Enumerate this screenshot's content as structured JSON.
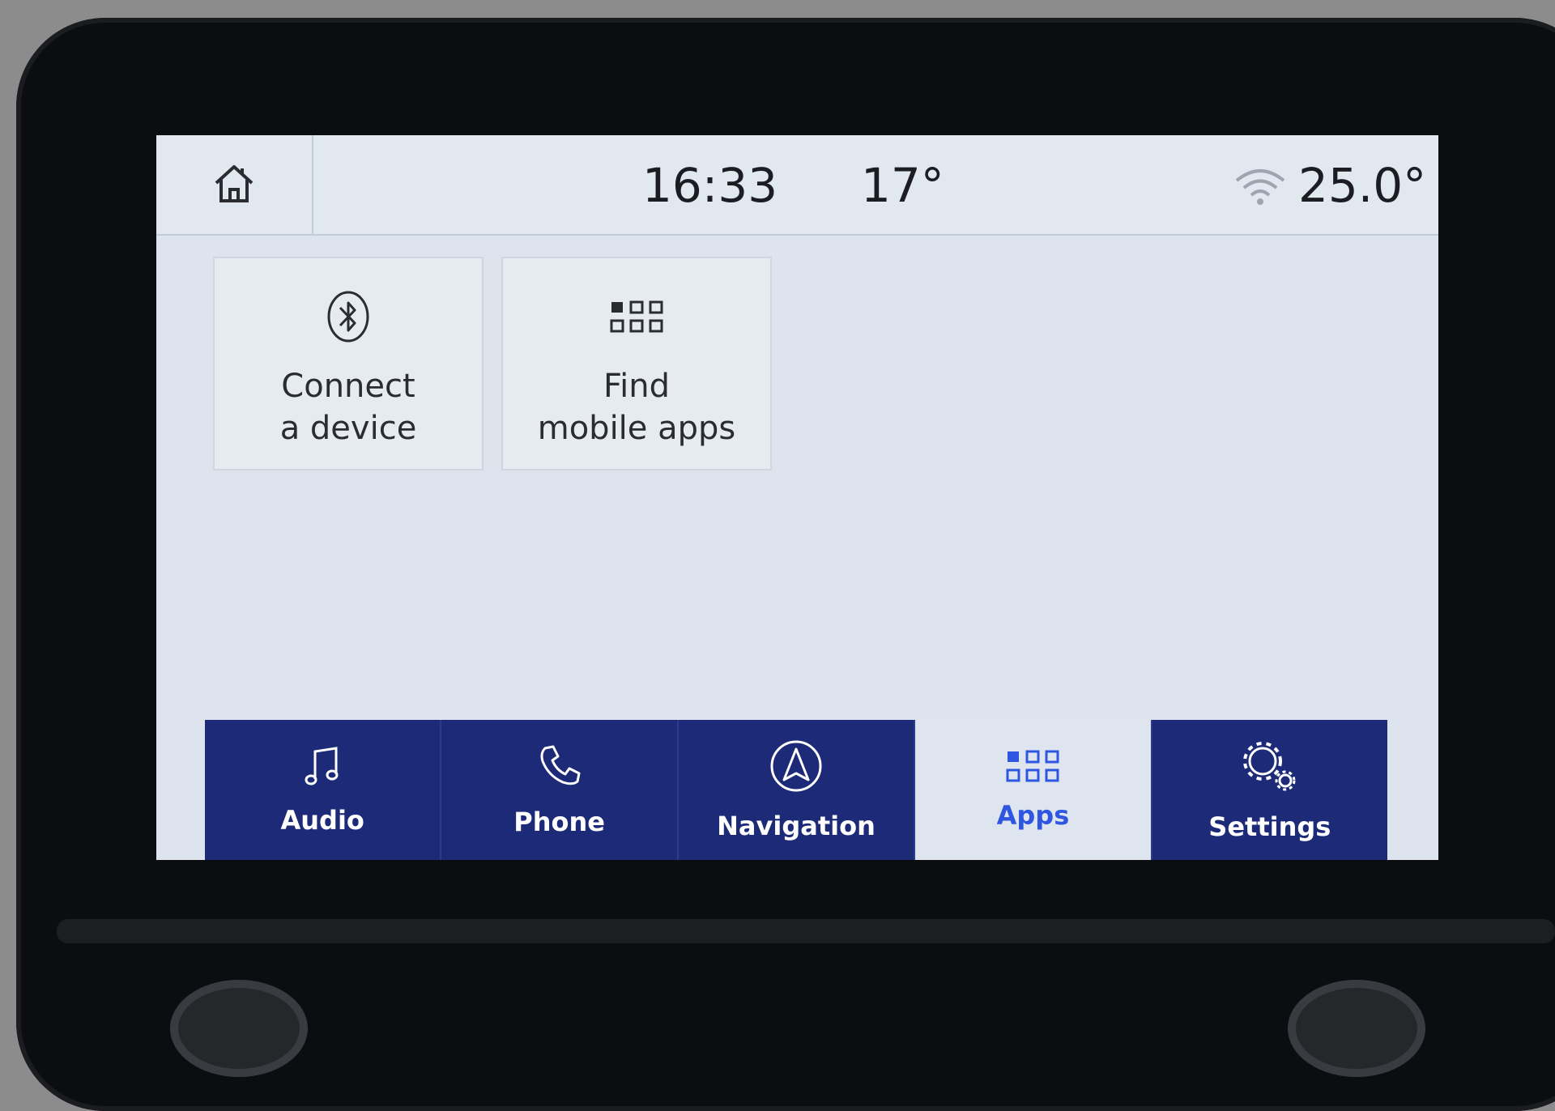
{
  "status_bar": {
    "time": "16:33",
    "outside_temp": "17°",
    "cabin_temp": "25.0°"
  },
  "tiles": [
    {
      "label": "Connect\na device",
      "icon": "bluetooth-icon"
    },
    {
      "label": "Find\nmobile apps",
      "icon": "app-grid-icon"
    }
  ],
  "nav": [
    {
      "label": "Audio",
      "icon": "music-note-icon",
      "active": false
    },
    {
      "label": "Phone",
      "icon": "phone-icon",
      "active": false
    },
    {
      "label": "Navigation",
      "icon": "navigation-arrow-icon",
      "active": false
    },
    {
      "label": "Apps",
      "icon": "app-grid-icon",
      "active": true
    },
    {
      "label": "Settings",
      "icon": "gears-icon",
      "active": false
    }
  ],
  "colors": {
    "nav_background": "#1c2a78",
    "active_tab_background": "#dfe5ef",
    "active_tab_text": "#2f56e0",
    "screen_background": "#dde4ee"
  }
}
